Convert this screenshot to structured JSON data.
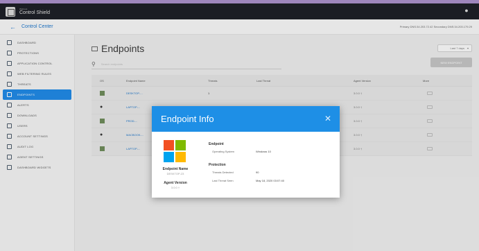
{
  "app": {
    "brand_small": "Webroot",
    "brand_main": "Control Shield",
    "user_icon": "user-icon"
  },
  "subbar": {
    "title": "Control Center",
    "dns": "Primary DNS:34.203.72.42  Secondary DNS:34.203.179.29"
  },
  "sidebar": {
    "items": [
      {
        "label": "Dashboard",
        "icon": "dashboard-icon",
        "active": false
      },
      {
        "label": "Protections",
        "icon": "protections-icon",
        "active": false
      },
      {
        "label": "Application Control",
        "icon": "application-control-icon",
        "active": false
      },
      {
        "label": "Web Filtering Rules",
        "icon": "web-filtering-icon",
        "active": false
      },
      {
        "label": "Threats",
        "icon": "threats-icon",
        "active": false
      },
      {
        "label": "Endpoints",
        "icon": "endpoints-icon",
        "active": true
      },
      {
        "label": "Alerts",
        "icon": "alerts-icon",
        "active": false
      },
      {
        "label": "Downloads",
        "icon": "downloads-icon",
        "active": false
      },
      {
        "label": "Users",
        "icon": "users-icon",
        "active": false
      },
      {
        "label": "Account Settings",
        "icon": "account-settings-icon",
        "active": false
      },
      {
        "label": "Audit Log",
        "icon": "audit-log-icon",
        "active": false
      },
      {
        "label": "Agent Settings",
        "icon": "agent-settings-icon",
        "active": false
      },
      {
        "label": "Dashboard Widgets",
        "icon": "dashboard-widgets-icon",
        "active": false
      }
    ]
  },
  "main": {
    "title": "Endpoints",
    "time_range": "Last 7 days",
    "search_placeholder": "Search endpoints",
    "new_button": "NEW ENDPOINT"
  },
  "table": {
    "columns": [
      "OS",
      "Endpoint Name",
      "Threats",
      "Last Threat",
      "Agent Version",
      "More"
    ],
    "rows": [
      {
        "os": "windows",
        "name": "DESKTOP-...",
        "threats": "1",
        "last": "",
        "agent": "3.0.0 †"
      },
      {
        "os": "apple",
        "name": "LAPTOP-...",
        "threats": "",
        "last": "",
        "agent": "3.0.0 †"
      },
      {
        "os": "windows",
        "name": "PROD-...",
        "threats": "",
        "last": "",
        "agent": "3.0.0 †"
      },
      {
        "os": "apple",
        "name": "MACBOOK-...",
        "threats": "",
        "last": "",
        "agent": "3.0.0 †"
      },
      {
        "os": "windows",
        "name": "LAPTOP-...",
        "threats": "",
        "last": "",
        "agent": "3.0.0 †"
      }
    ]
  },
  "modal": {
    "title": "Endpoint Info",
    "endpoint_name_label": "Endpoint Name",
    "endpoint_name_value": "DESKTOP-23",
    "agent_version_label": "Agent Version",
    "agent_version_value": "3.0.0 †",
    "section_endpoint": "Endpoint",
    "os_key": "Operating System",
    "os_value": "Windows 10",
    "section_protection": "Protection",
    "threats_key": "Threats Detected",
    "threats_value": "90",
    "last_threat_key": "Last Threat Seen",
    "last_threat_value": "May 18, 2020 03:07:40"
  }
}
